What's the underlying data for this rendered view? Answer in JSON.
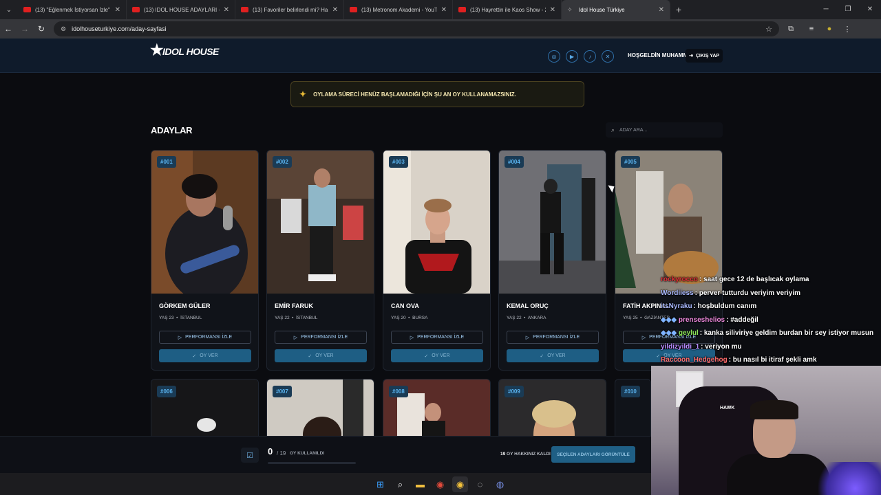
{
  "browser": {
    "tabs": [
      {
        "title": "(13) \"Eğlenmek İstiyorsan İzle\" – Y",
        "icon": "youtube-icon"
      },
      {
        "title": "(13) IDOL HOUSE ADAYLARI - Y",
        "icon": "youtube-icon"
      },
      {
        "title": "(13) Favoriler belirlendi mi? Ha",
        "icon": "youtube-icon"
      },
      {
        "title": "(13) Metronom Akademi - YouT",
        "icon": "youtube-icon"
      },
      {
        "title": "(13) Hayrettin ile Kaos Show - 2",
        "icon": "youtube-icon"
      },
      {
        "title": "Idol House Türkiye",
        "icon": "idol-house-icon"
      }
    ],
    "url": "idolhouseturkiye.com/aday-sayfasi"
  },
  "header": {
    "logo_text": "IDOL HOUSE",
    "social": [
      "instagram-icon",
      "youtube-icon",
      "tiktok-icon",
      "x-icon"
    ],
    "greeting": "HOŞGELDİN MUHAMMED",
    "logout": "ÇIKIŞ YAP"
  },
  "notice": "OYLAMA SÜRECİ HENÜZ BAŞLAMADIĞI İÇİN ŞU AN OY KULLANAMAZSINIZ.",
  "section_title": "ADAYLAR",
  "search": {
    "placeholder": "ADAY ARA..."
  },
  "candidates": [
    {
      "num": "#001",
      "name": "GÖRKEM GÜLER",
      "age": "YAŞ 23",
      "city": "İSTANBUL",
      "perf": "PERFORMANSI İZLE",
      "vote": "OY VER"
    },
    {
      "num": "#002",
      "name": "EMİR FARUK",
      "age": "YAŞ 22",
      "city": "İSTANBUL",
      "perf": "PERFORMANSI İZLE",
      "vote": "OY VER"
    },
    {
      "num": "#003",
      "name": "CAN OVA",
      "age": "YAŞ 20",
      "city": "BURSA",
      "perf": "PERFORMANSI İZLE",
      "vote": "OY VER"
    },
    {
      "num": "#004",
      "name": "KEMAL ORUÇ",
      "age": "YAŞ 22",
      "city": "ANKARA",
      "perf": "PERFORMANSI İZLE",
      "vote": "OY VER"
    },
    {
      "num": "#005",
      "name": "FATİH AKPINAL",
      "age": "YAŞ 25",
      "city": "GAZİANTEP",
      "perf": "PERFORMANSI İZLE",
      "vote": "OY VER"
    }
  ],
  "candidates_row2": [
    "#006",
    "#007",
    "#008",
    "#009",
    "#010"
  ],
  "bottom": {
    "count": "0",
    "total": "/ 19",
    "used_label": "OY KULLANILDI",
    "left_count": "19",
    "left_label": "OY HAKKINIZ KALDI",
    "button": "SEÇİLEN ADAYLARI GÖRÜNTÜLE"
  },
  "chat": [
    {
      "user": "rockyrocco",
      "msg": ": saat gece 12 de başlıcak oylama",
      "color": "#e0303a"
    },
    {
      "user": "Wordiiess",
      "msg": ": perver tutturdu veriyim veriyim",
      "color": "#a8b8ff"
    },
    {
      "user": "itsNyraku",
      "msg": ": hoşbuldum canım",
      "color": "#a8b8ff"
    },
    {
      "user": "prenseshelios",
      "msg": ": #addeğil",
      "color": "#f08adf"
    },
    {
      "user": "geylul",
      "msg": ": kanka siliviriye geldim burdan bir sey istiyor musun",
      "color": "#8ee85a"
    },
    {
      "user": "yildizyildi_1",
      "msg": ": veriyon mu",
      "color": "#b98cff"
    },
    {
      "user": "Raccoon_Hedgehog",
      "msg": ": bu nasıl bi itiraf şekli amk",
      "color": "#ff6b6b"
    }
  ],
  "webcam": {
    "chair_brand": "HAWK"
  },
  "colors": {
    "accent": "#1e5e84",
    "badge": "#5ab4f0",
    "notice": "#e7b936"
  }
}
